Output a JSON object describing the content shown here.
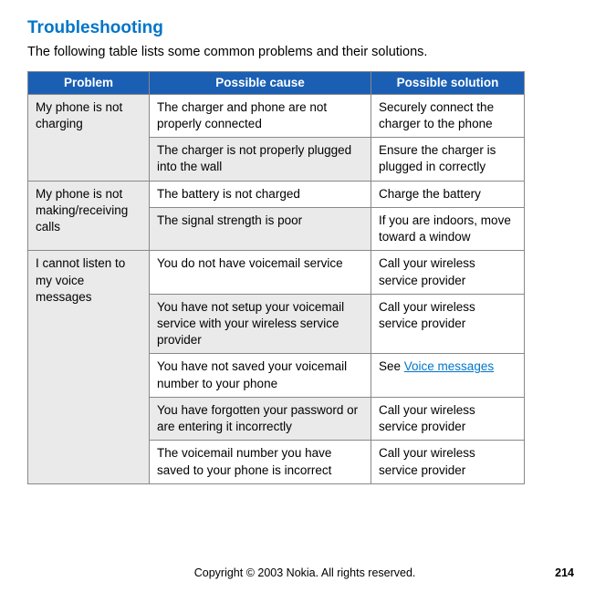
{
  "heading": "Troubleshooting",
  "intro": "The following table lists some common problems and their solutions.",
  "headers": {
    "problem": "Problem",
    "cause": "Possible cause",
    "solution": "Possible solution"
  },
  "rows": {
    "r1": {
      "problem": "My phone is not charging",
      "cause": "The charger and phone are not properly connected",
      "solution": "Securely connect the charger to the phone"
    },
    "r2": {
      "cause": "The charger is not properly plugged into the wall",
      "solution": "Ensure the charger is plugged in correctly"
    },
    "r3": {
      "problem": "My phone is not making/receiving calls",
      "cause": "The battery is not charged",
      "solution": "Charge the battery"
    },
    "r4": {
      "cause": "The signal strength is poor",
      "solution": "If you are indoors, move toward a window"
    },
    "r5": {
      "problem": "I cannot listen to my voice messages",
      "cause": "You do not have voicemail service",
      "solution": "Call your wireless service provider"
    },
    "r6": {
      "cause": "You have not setup your voicemail service with your wireless service provider",
      "solution": "Call your wireless service provider"
    },
    "r7": {
      "cause": "You have not saved your voicemail number to your phone",
      "solution_prefix": "See ",
      "solution_link": "Voice messages"
    },
    "r8": {
      "cause": "You have forgotten your password or are entering it incorrectly",
      "solution": "Call your wireless service provider"
    },
    "r9": {
      "cause": "The voicemail number you have saved to your phone is incorrect",
      "solution": "Call your wireless service provider"
    }
  },
  "footer": {
    "copyright": "Copyright © 2003 Nokia. All rights reserved.",
    "page": "214"
  }
}
